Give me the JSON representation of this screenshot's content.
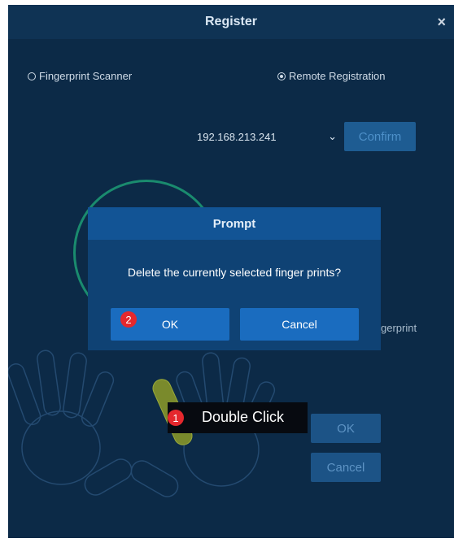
{
  "dialog": {
    "title": "Register",
    "close_glyph": "×",
    "radio_options": [
      {
        "label": "Fingerprint Scanner",
        "checked": false
      },
      {
        "label": "Remote Registration",
        "checked": true
      }
    ],
    "ip_select": {
      "value": "192.168.213.241",
      "chevron": "⌄"
    },
    "confirm_label": "Confirm",
    "partial_label": "gerprint",
    "ok_label": "OK",
    "cancel_label": "Cancel"
  },
  "tooltip": {
    "step": "1",
    "text": "Double Click"
  },
  "prompt": {
    "title": "Prompt",
    "message": "Delete the currently selected finger prints?",
    "ok_step": "2",
    "ok_label": "OK",
    "cancel_label": "Cancel"
  },
  "colors": {
    "dialog_bg": "#0c2a47",
    "prompt_bg": "#0f4274",
    "prompt_button": "#1a6cbf",
    "ring": "#1a8b6e",
    "selected_finger": "#7a8a2c",
    "badge": "#e5282d"
  },
  "icons": [
    "close-icon",
    "chevron-down-icon",
    "hands-outline-icon"
  ]
}
